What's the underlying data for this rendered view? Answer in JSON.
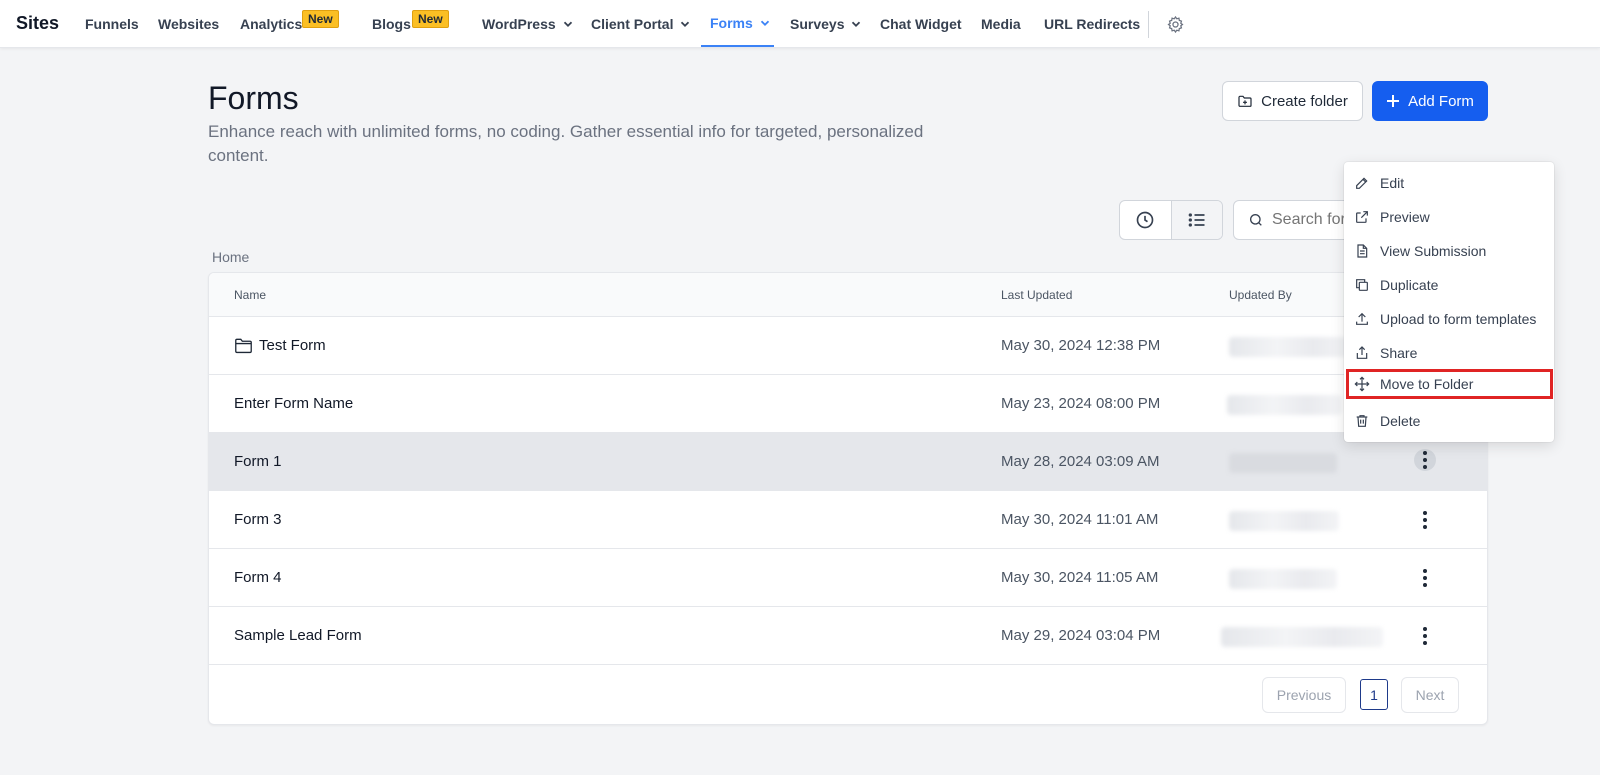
{
  "app": {
    "brand": "Sites"
  },
  "nav": {
    "items": [
      {
        "label": "Funnels"
      },
      {
        "label": "Websites"
      },
      {
        "label": "Analytics",
        "badge": "New"
      },
      {
        "label": "Blogs",
        "badge": "New"
      },
      {
        "label": "WordPress"
      },
      {
        "label": "Client Portal"
      },
      {
        "label": "Forms",
        "active": true
      },
      {
        "label": "Surveys"
      },
      {
        "label": "Chat Widget"
      },
      {
        "label": "Media"
      },
      {
        "label": "URL Redirects"
      }
    ],
    "settings_icon": "gear-icon",
    "accent_color": "#3b82f6"
  },
  "header": {
    "title": "Forms",
    "description": "Enhance reach with unlimited forms, no coding. Gather essential info for targeted, personalized content.",
    "create_folder_label": "Create folder",
    "add_form_label": "Add Form",
    "primary_color": "#155eef"
  },
  "toolbar": {
    "search_placeholder": "Search for f"
  },
  "breadcrumb": "Home",
  "table": {
    "columns": {
      "name": "Name",
      "last_updated": "Last Updated",
      "updated_by": "Updated By"
    },
    "rows": [
      {
        "name": "Test Form",
        "last_updated": "May 30, 2024 12:38 PM",
        "is_folder": true
      },
      {
        "name": "Enter Form Name",
        "last_updated": "May 23, 2024 08:00 PM"
      },
      {
        "name": "Form 1",
        "last_updated": "May 28, 2024 03:09 AM",
        "highlighted": true
      },
      {
        "name": "Form 3",
        "last_updated": "May 30, 2024 11:01 AM"
      },
      {
        "name": "Form 4",
        "last_updated": "May 30, 2024 11:05 AM"
      },
      {
        "name": "Sample Lead Form",
        "last_updated": "May 29, 2024 03:04 PM"
      }
    ]
  },
  "pagination": {
    "previous": "Previous",
    "page": "1",
    "next": "Next"
  },
  "context_menu": {
    "items": [
      {
        "label": "Edit",
        "icon": "pencil-icon"
      },
      {
        "label": "Preview",
        "icon": "external-link-icon"
      },
      {
        "label": "View Submission",
        "icon": "document-icon"
      },
      {
        "label": "Duplicate",
        "icon": "copy-icon"
      },
      {
        "label": "Upload to form templates",
        "icon": "upload-icon"
      },
      {
        "label": "Share",
        "icon": "share-icon"
      },
      {
        "label": "Move to Folder",
        "icon": "move-icon",
        "outlined": true
      },
      {
        "label": "Delete",
        "icon": "trash-icon"
      }
    ],
    "outline_color": "#e02424"
  }
}
